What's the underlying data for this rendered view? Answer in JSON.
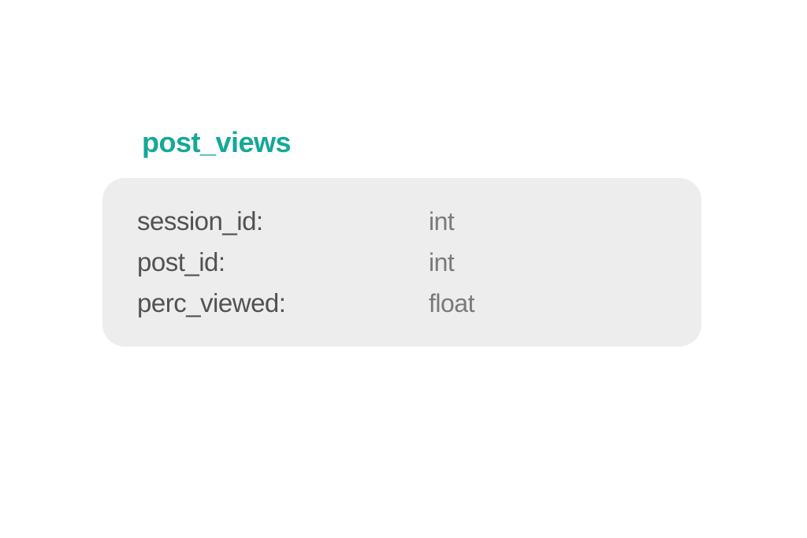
{
  "schema": {
    "title": "post_views",
    "fields": [
      {
        "name": "session_id:",
        "type": "int"
      },
      {
        "name": "post_id:",
        "type": "int"
      },
      {
        "name": "perc_viewed:",
        "type": "float"
      }
    ]
  }
}
